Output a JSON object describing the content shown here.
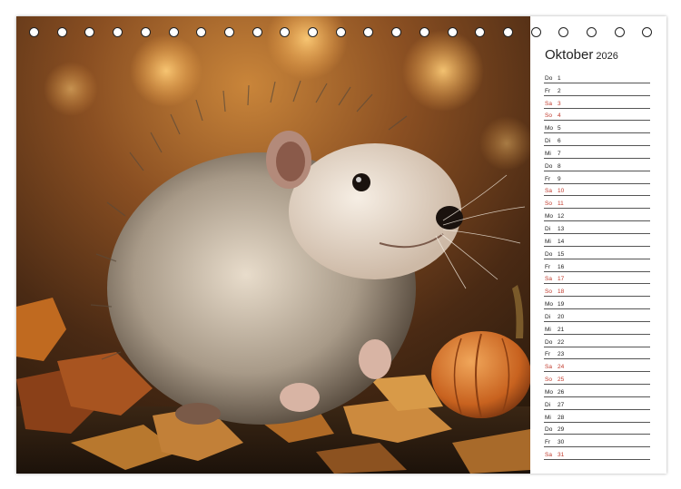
{
  "calendar": {
    "month": "Oktober",
    "year": "2026",
    "weekend_color": "#c0392b",
    "days": [
      {
        "wd": "Do",
        "d": "1"
      },
      {
        "wd": "Fr",
        "d": "2"
      },
      {
        "wd": "Sa",
        "d": "3",
        "we": true
      },
      {
        "wd": "So",
        "d": "4",
        "we": true
      },
      {
        "wd": "Mo",
        "d": "5"
      },
      {
        "wd": "Di",
        "d": "6"
      },
      {
        "wd": "Mi",
        "d": "7"
      },
      {
        "wd": "Do",
        "d": "8"
      },
      {
        "wd": "Fr",
        "d": "9"
      },
      {
        "wd": "Sa",
        "d": "10",
        "we": true
      },
      {
        "wd": "So",
        "d": "11",
        "we": true
      },
      {
        "wd": "Mo",
        "d": "12"
      },
      {
        "wd": "Di",
        "d": "13"
      },
      {
        "wd": "Mi",
        "d": "14"
      },
      {
        "wd": "Do",
        "d": "15"
      },
      {
        "wd": "Fr",
        "d": "16"
      },
      {
        "wd": "Sa",
        "d": "17",
        "we": true
      },
      {
        "wd": "So",
        "d": "18",
        "we": true
      },
      {
        "wd": "Mo",
        "d": "19"
      },
      {
        "wd": "Di",
        "d": "20"
      },
      {
        "wd": "Mi",
        "d": "21"
      },
      {
        "wd": "Do",
        "d": "22"
      },
      {
        "wd": "Fr",
        "d": "23"
      },
      {
        "wd": "Sa",
        "d": "24",
        "we": true
      },
      {
        "wd": "So",
        "d": "25",
        "we": true
      },
      {
        "wd": "Mo",
        "d": "26"
      },
      {
        "wd": "Di",
        "d": "27"
      },
      {
        "wd": "Mi",
        "d": "28"
      },
      {
        "wd": "Do",
        "d": "29"
      },
      {
        "wd": "Fr",
        "d": "30"
      },
      {
        "wd": "Sa",
        "d": "31",
        "we": true
      }
    ]
  },
  "photo": {
    "subject": "hedgehog-among-autumn-leaves-with-pumpkin"
  }
}
